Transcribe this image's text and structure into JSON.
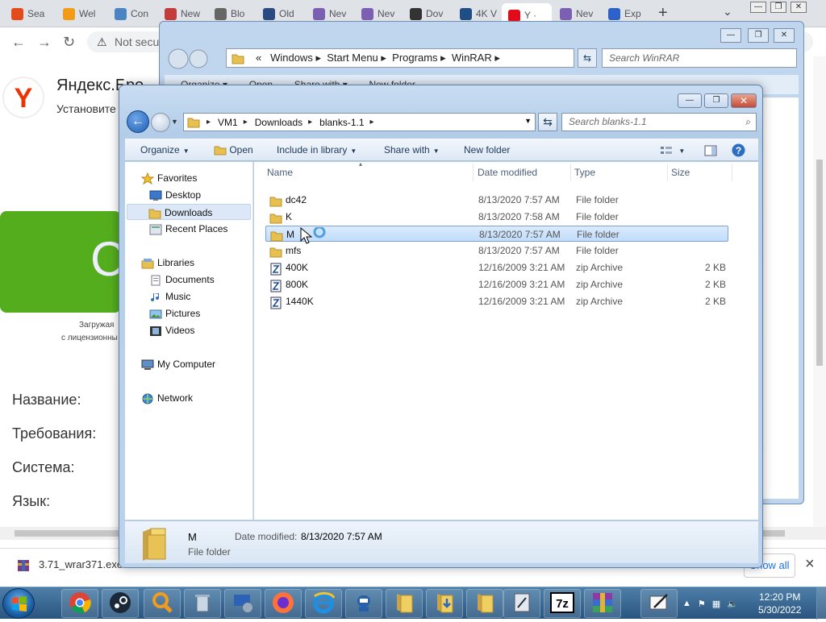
{
  "browser": {
    "tabs": [
      {
        "label": "Sea",
        "favicon_color": "#e34b1a"
      },
      {
        "label": "Wel",
        "favicon_color": "#f19b16"
      },
      {
        "label": "Con",
        "favicon_color": "#4a84c4"
      },
      {
        "label": "New",
        "favicon_color": "#c33b3b"
      },
      {
        "label": "Blo",
        "favicon_color": "#666666"
      },
      {
        "label": "Old",
        "favicon_color": "#2a4a82"
      },
      {
        "label": "Nev",
        "favicon_color": "#7b5fb2"
      },
      {
        "label": "Nev",
        "favicon_color": "#7b5fb2"
      },
      {
        "label": "Dov",
        "favicon_color": "#333333"
      },
      {
        "label": "4K V",
        "favicon_color": "#1f4d86"
      },
      {
        "label": "Y ·",
        "favicon_color": "#e30b1a",
        "active": true
      },
      {
        "label": "Nev",
        "favicon_color": "#7b5fb2"
      },
      {
        "label": "Exp",
        "favicon_color": "#2c62c9"
      }
    ],
    "new_tab": "+",
    "tab_menu": "⌄",
    "omnibox_text": "Not secu",
    "page": {
      "logo_letter": "Y",
      "title": "Яндекс.Бро",
      "subtitle": "Установите",
      "button_letter": "С",
      "small_line1": "Загружая",
      "small_line2": "с лицензионны",
      "props": [
        "Название:",
        "Требования:",
        "Система:",
        "Язык:"
      ]
    },
    "download": {
      "file": "3.71_wrar371.exe",
      "show_all": "Show all",
      "close": "×"
    }
  },
  "back_window": {
    "address": [
      "«",
      "Windows",
      "Start Menu",
      "Programs",
      "WinRAR"
    ],
    "search_placeholder": "Search WinRAR",
    "toolbar": [
      "Organize",
      "Open",
      "Share with",
      "New folder"
    ]
  },
  "explorer": {
    "address": [
      "VM1",
      "Downloads",
      "blanks-1.1"
    ],
    "search_placeholder": "Search blanks-1.1",
    "toolbar": {
      "organize": "Organize",
      "open": "Open",
      "include": "Include in library",
      "share": "Share with",
      "new_folder": "New folder"
    },
    "nav": {
      "favorites": "Favorites",
      "desktop": "Desktop",
      "downloads": "Downloads",
      "recent": "Recent Places",
      "libraries": "Libraries",
      "documents": "Documents",
      "music": "Music",
      "pictures": "Pictures",
      "videos": "Videos",
      "computer": "My Computer",
      "network": "Network"
    },
    "columns": {
      "name": "Name",
      "date": "Date modified",
      "type": "Type",
      "size": "Size"
    },
    "files": [
      {
        "name": "dc42",
        "date": "8/13/2020 7:57 AM",
        "type": "File folder",
        "size": "",
        "kind": "folder"
      },
      {
        "name": "K",
        "date": "8/13/2020 7:58 AM",
        "type": "File folder",
        "size": "",
        "kind": "folder"
      },
      {
        "name": "M",
        "date": "8/13/2020 7:57 AM",
        "type": "File folder",
        "size": "",
        "kind": "folder",
        "selected": true
      },
      {
        "name": "mfs",
        "date": "8/13/2020 7:57 AM",
        "type": "File folder",
        "size": "",
        "kind": "folder"
      },
      {
        "name": "400K",
        "date": "12/16/2009 3:21 AM",
        "type": "zip Archive",
        "size": "2 KB",
        "kind": "zip"
      },
      {
        "name": "800K",
        "date": "12/16/2009 3:21 AM",
        "type": "zip Archive",
        "size": "2 KB",
        "kind": "zip"
      },
      {
        "name": "1440K",
        "date": "12/16/2009 3:21 AM",
        "type": "zip Archive",
        "size": "2 KB",
        "kind": "zip"
      }
    ],
    "status": {
      "name": "M",
      "date_label": "Date modified:",
      "date_value": "8/13/2020 7:57 AM",
      "type": "File folder"
    }
  },
  "taskbar": {
    "icons": [
      "chrome-icon",
      "steam-icon",
      "search-icon",
      "recycle-bin-icon",
      "network-drive-icon",
      "firefox-icon",
      "internet-explorer-icon",
      "robot-icon",
      "folder-icon",
      "downloads-folder-icon",
      "folder-icon",
      "vm-icon",
      "7zip-icon",
      "winrar-icon"
    ],
    "seven_zip_label": "7z",
    "clock": {
      "time": "12:20 PM",
      "date": "5/30/2022"
    }
  },
  "colors": {
    "accent": "#3c7fd1",
    "selection": "#cde3fb",
    "yandex_green": "#54ad1d",
    "taskbar": "#29547f"
  }
}
